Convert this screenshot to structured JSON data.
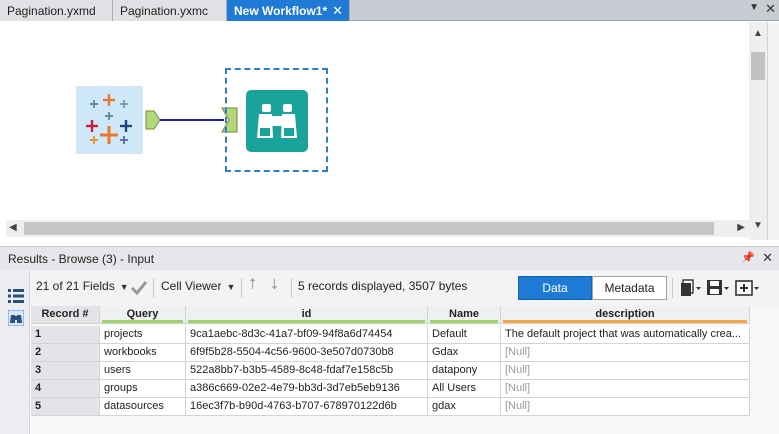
{
  "tabs": [
    {
      "label": "Pagination.yxmd"
    },
    {
      "label": "Pagination.yxmc"
    },
    {
      "label": "New Workflow1*"
    }
  ],
  "tab_close_glyph": "✕",
  "canvas": {
    "tools": [
      {
        "name": "Tableau input",
        "icon": "tableau-logo-icon"
      },
      {
        "name": "Browse",
        "icon": "binoculars-icon"
      }
    ]
  },
  "results": {
    "title": "Results - Browse (3) - Input",
    "fields_selector": "21 of 21 Fields",
    "viewer_selector": "Cell Viewer",
    "status": "5 records displayed, 3507 bytes",
    "data_tab": "Data",
    "metadata_tab": "Metadata",
    "columns": [
      "Record #",
      "Query",
      "id",
      "Name",
      "description"
    ],
    "rows": [
      {
        "rec": "1",
        "query": "projects",
        "id": "9ca1aebc-8d3c-41a7-bf09-94f8a6d74454",
        "name": "Default",
        "description": "The default project that was automatically crea..."
      },
      {
        "rec": "2",
        "query": "workbooks",
        "id": "6f9f5b28-5504-4c56-9600-3e507d0730b8",
        "name": "Gdax",
        "description": "[Null]"
      },
      {
        "rec": "3",
        "query": "users",
        "id": "522a8bb7-b3b5-4589-8c48-fdaf7e158c5b",
        "name": "datapony",
        "description": "[Null]"
      },
      {
        "rec": "4",
        "query": "groups",
        "id": "a386c669-02e2-4e79-bb3d-3d7eb5eb9136",
        "name": "All Users",
        "description": "[Null]"
      },
      {
        "rec": "5",
        "query": "datasources",
        "id": "16ec3f7b-b90d-4763-b707-678970122d6b",
        "name": "gdax",
        "description": "[Null]"
      }
    ]
  },
  "colors": {
    "accent": "#1f7ad6",
    "browse_tool": "#1aa39a",
    "connector": "#1a1ab8",
    "anchor": "#b6d67a"
  }
}
